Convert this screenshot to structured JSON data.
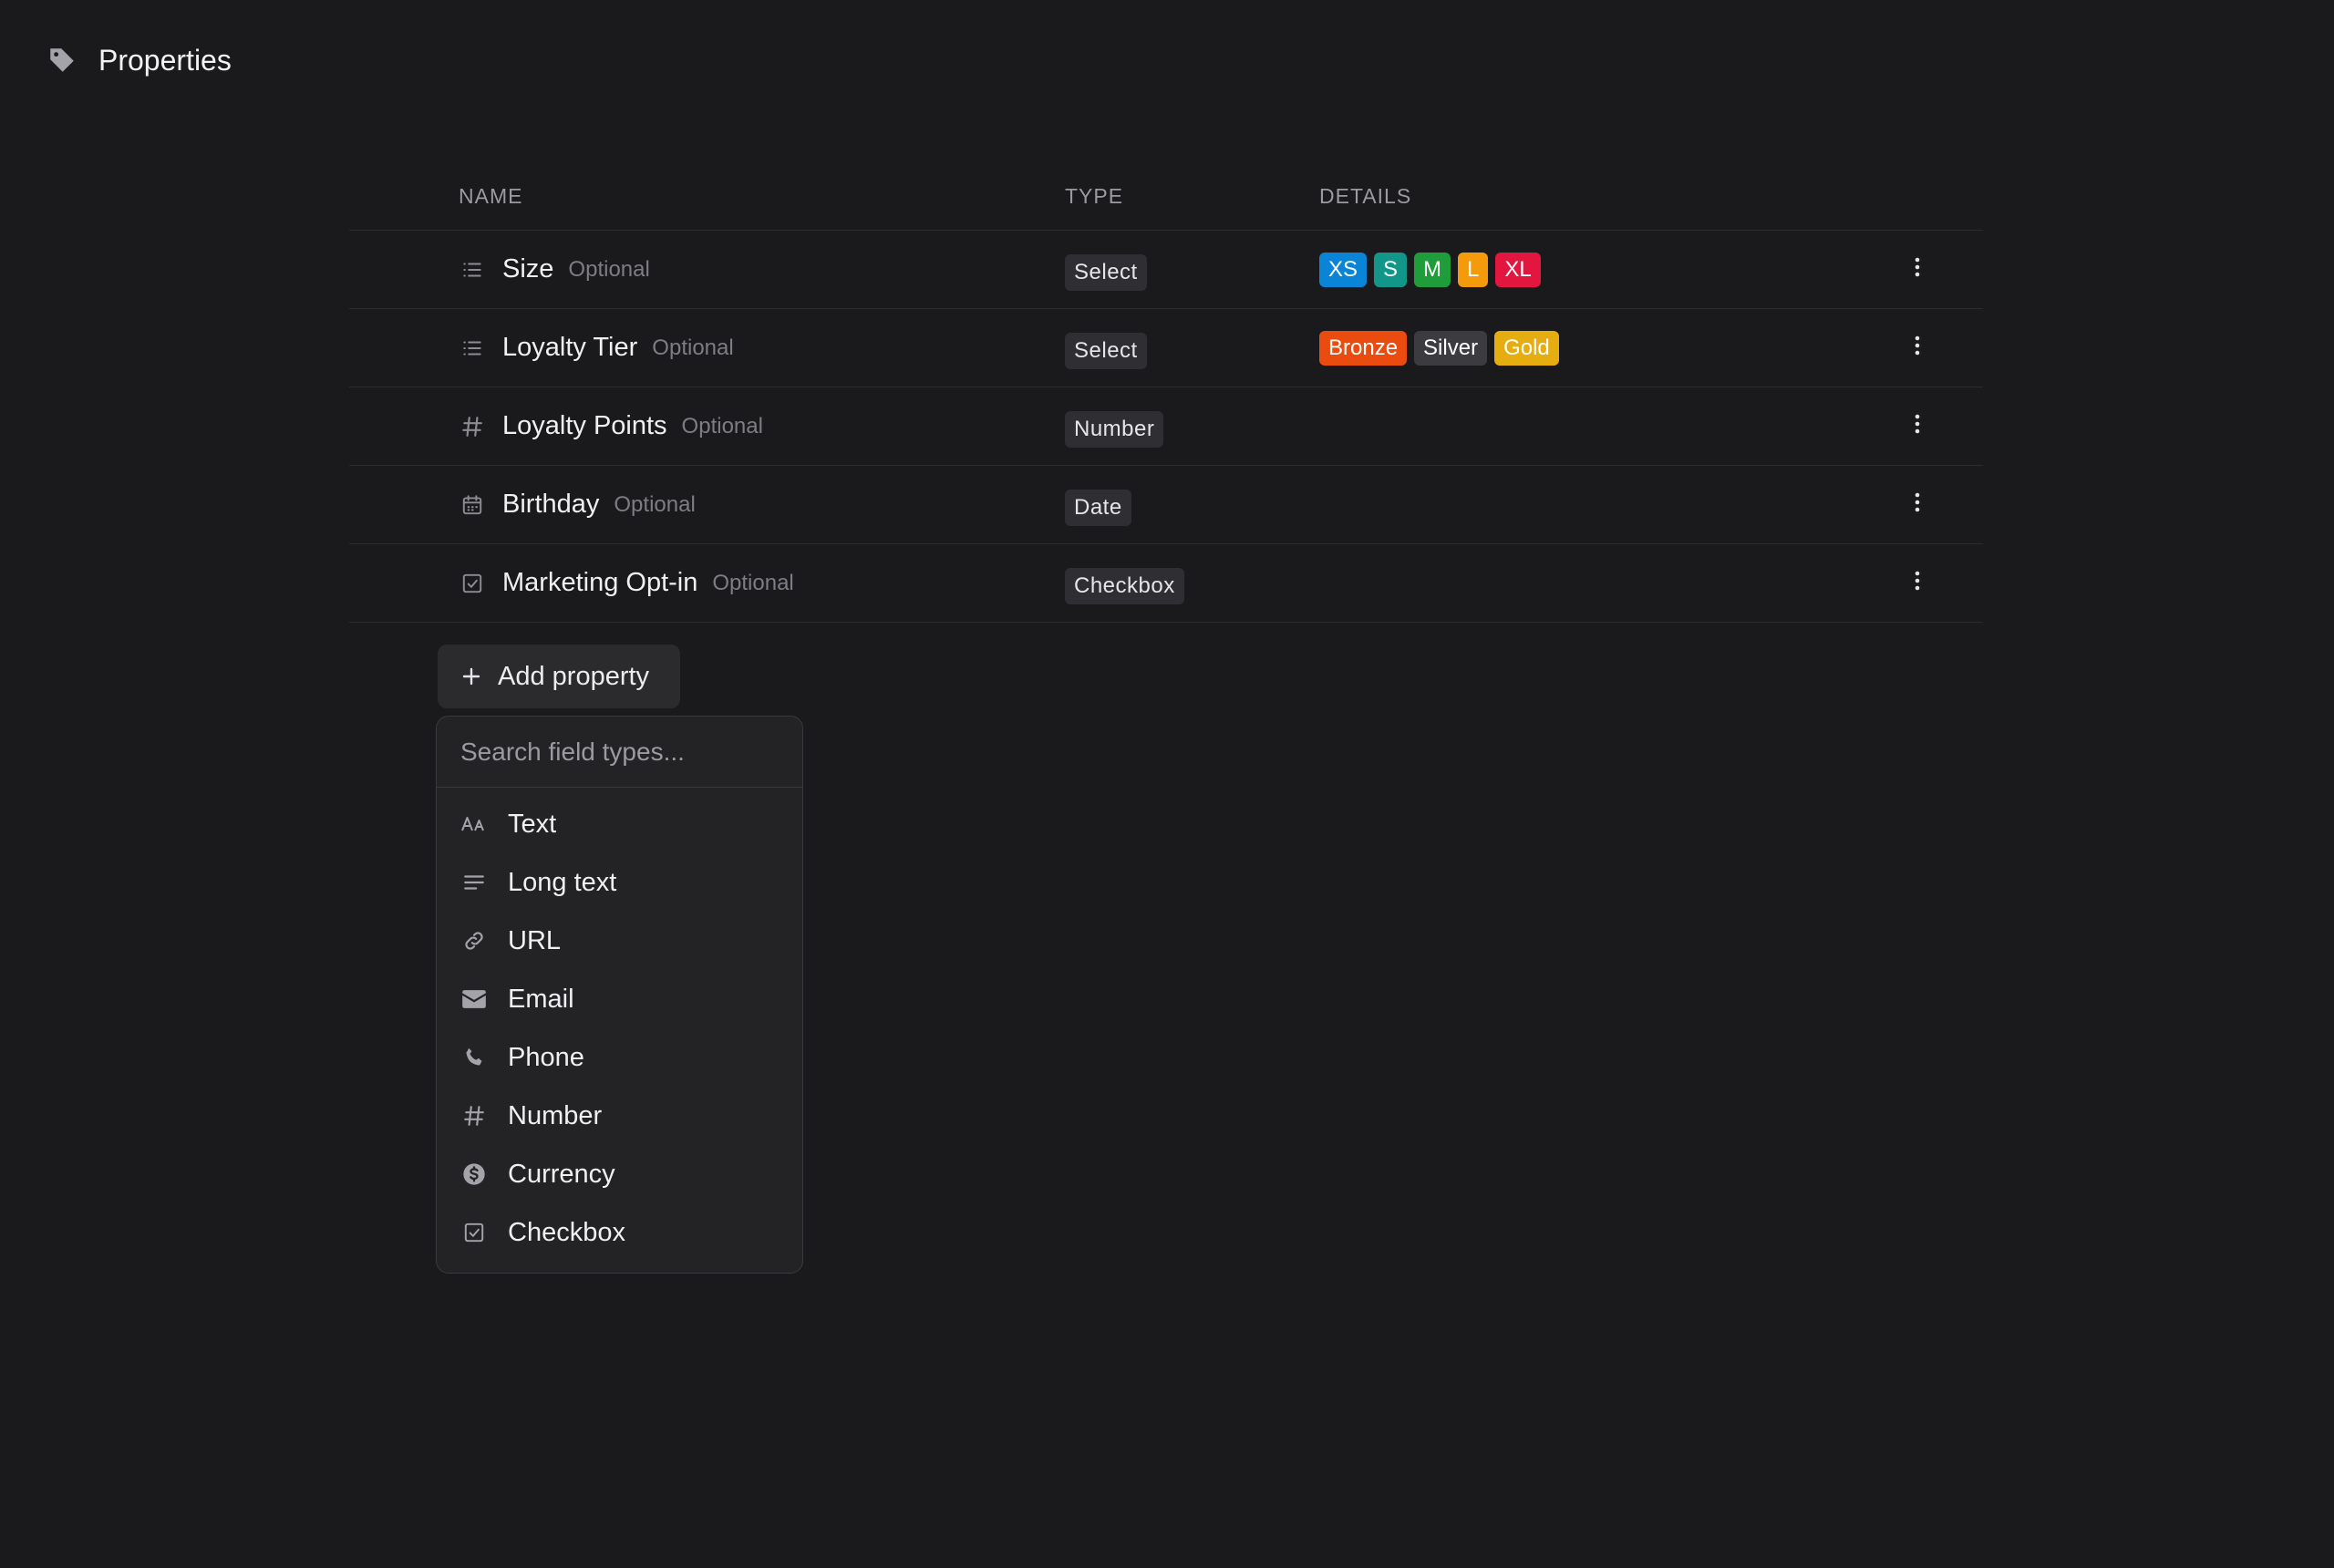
{
  "header": {
    "title": "Properties",
    "icon": "tag-icon"
  },
  "table": {
    "columns": {
      "name": "NAME",
      "type": "TYPE",
      "details": "DETAILS"
    },
    "rows": [
      {
        "icon": "list-icon",
        "name": "Size",
        "optional": "Optional",
        "type": "Select",
        "chips": [
          {
            "label": "XS",
            "color": "#0a84d6"
          },
          {
            "label": "S",
            "color": "#13968a"
          },
          {
            "label": "M",
            "color": "#1f9d3a"
          },
          {
            "label": "L",
            "color": "#f59a0b"
          },
          {
            "label": "XL",
            "color": "#e3163f"
          }
        ]
      },
      {
        "icon": "list-icon",
        "name": "Loyalty Tier",
        "optional": "Optional",
        "type": "Select",
        "chips": [
          {
            "label": "Bronze",
            "color": "#ea4b0e"
          },
          {
            "label": "Silver",
            "color": "#3b3b40"
          },
          {
            "label": "Gold",
            "color": "#e6ad11"
          }
        ]
      },
      {
        "icon": "hash-icon",
        "name": "Loyalty Points",
        "optional": "Optional",
        "type": "Number",
        "chips": []
      },
      {
        "icon": "calendar-icon",
        "name": "Birthday",
        "optional": "Optional",
        "type": "Date",
        "chips": []
      },
      {
        "icon": "checkbox-icon",
        "name": "Marketing Opt-in",
        "optional": "Optional",
        "type": "Checkbox",
        "chips": []
      }
    ]
  },
  "add_button": {
    "label": "Add property"
  },
  "dropdown": {
    "search_placeholder": "Search field types...",
    "options": [
      {
        "label": "Text",
        "icon": "text-icon"
      },
      {
        "label": "Long text",
        "icon": "long-text-icon"
      },
      {
        "label": "URL",
        "icon": "link-icon"
      },
      {
        "label": "Email",
        "icon": "envelope-icon"
      },
      {
        "label": "Phone",
        "icon": "phone-icon"
      },
      {
        "label": "Number",
        "icon": "hash-icon"
      },
      {
        "label": "Currency",
        "icon": "currency-icon"
      },
      {
        "label": "Checkbox",
        "icon": "checkbox-icon"
      }
    ]
  }
}
